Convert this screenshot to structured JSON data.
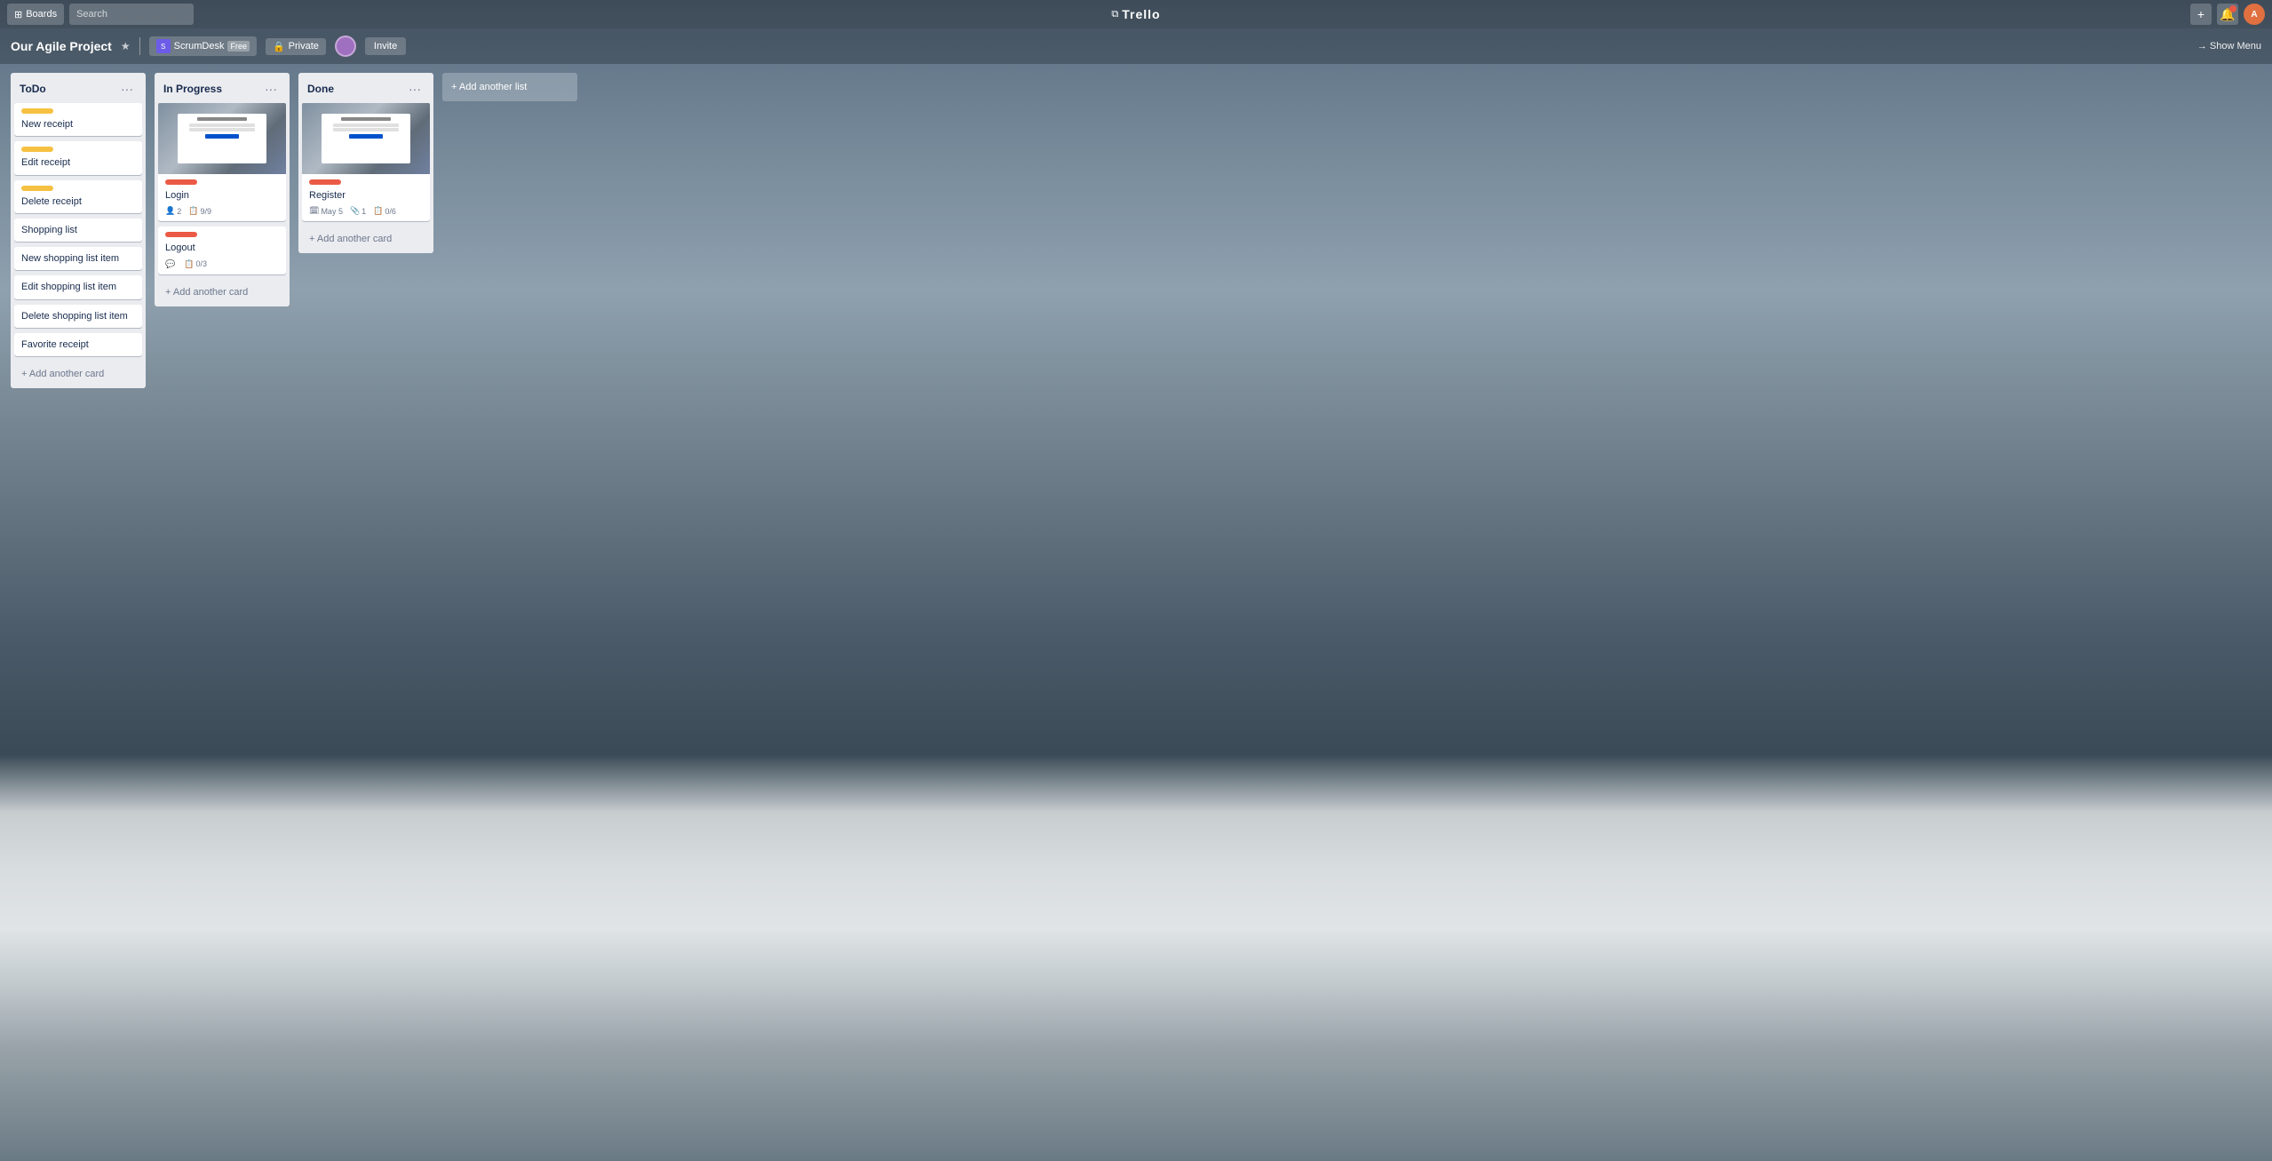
{
  "topbar": {
    "boards_label": "Boards",
    "search_placeholder": "Search",
    "trello_logo": "Trello",
    "add_icon": "+",
    "bell_icon": "🔔",
    "avatar_initials": "A"
  },
  "board_header": {
    "title": "Our Agile Project",
    "star_icon": "★",
    "workspace_name": "ScrumDesk",
    "workspace_badge": "Free",
    "privacy_label": "Private",
    "invite_label": "Invite",
    "show_menu_label": "→  Show Menu"
  },
  "lists": [
    {
      "id": "todo",
      "title": "ToDo",
      "cards": [
        {
          "id": "c1",
          "label": "yellow",
          "title": "New receipt"
        },
        {
          "id": "c2",
          "label": "yellow",
          "title": "Edit receipt"
        },
        {
          "id": "c3",
          "label": "yellow",
          "title": "Delete receipt"
        },
        {
          "id": "c4",
          "label": "",
          "title": "Shopping list"
        },
        {
          "id": "c5",
          "label": "",
          "title": "New shopping list item"
        },
        {
          "id": "c6",
          "label": "",
          "title": "Edit shopping list item"
        },
        {
          "id": "c7",
          "label": "",
          "title": "Delete shopping list item"
        },
        {
          "id": "c8",
          "label": "",
          "title": "Favorite receipt"
        }
      ],
      "add_card_label": "+ Add another card"
    },
    {
      "id": "inprogress",
      "title": "In Progress",
      "cards": [
        {
          "id": "c9",
          "label": "red",
          "title": "Login",
          "has_image": true,
          "meta": [
            {
              "icon": "👤",
              "value": "2"
            },
            {
              "icon": "📋",
              "value": "9/9"
            }
          ]
        },
        {
          "id": "c10",
          "label": "red",
          "title": "Logout",
          "has_image": false,
          "meta": [
            {
              "icon": "💬",
              "value": ""
            },
            {
              "icon": "📋",
              "value": "0/3"
            }
          ]
        }
      ],
      "add_card_label": "+ Add another card"
    },
    {
      "id": "done",
      "title": "Done",
      "cards": [
        {
          "id": "c11",
          "label": "red",
          "title": "Register",
          "has_image": true,
          "meta": [
            {
              "icon": "🗓",
              "value": "May 5"
            },
            {
              "icon": "📎",
              "value": "1"
            },
            {
              "icon": "📋",
              "value": "0/6"
            }
          ]
        }
      ],
      "add_card_label": "+ Add another card"
    }
  ],
  "add_list_label": "+ Add another list"
}
